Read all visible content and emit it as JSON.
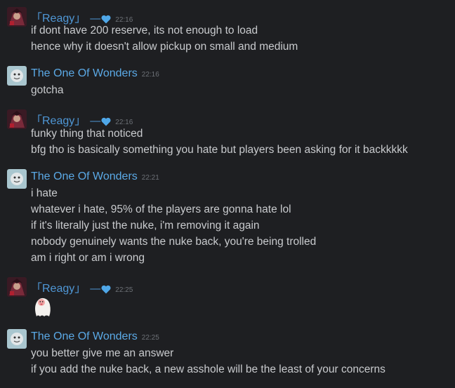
{
  "colors": {
    "background": "#1e1f22",
    "name_color": "#5ba9e6",
    "reagy_color": "#4f97d6",
    "heart": "#4fa7e8",
    "time": "#6d7177",
    "text": "#c9cbce"
  },
  "messages": [
    {
      "author": "「Reagy」",
      "decoration": "—",
      "decoration_icon": "heart-icon",
      "time": "22:16",
      "avatar": "reagy-avatar",
      "lines": [
        "if dont have 200 reserve, its not enough to load",
        "hence why it doesn't allow pickup on small and medium"
      ]
    },
    {
      "author": "The One Of Wonders",
      "time": "22:16",
      "avatar": "wonders-avatar",
      "lines": [
        "gotcha"
      ]
    },
    {
      "author": "「Reagy」",
      "decoration": "—",
      "decoration_icon": "heart-icon",
      "time": "22:16",
      "avatar": "reagy-avatar",
      "lines": [
        "funky thing that noticed",
        "bfg tho is basically something you hate but players been asking for it backkkkk"
      ]
    },
    {
      "author": "The One Of Wonders",
      "time": "22:21",
      "avatar": "wonders-avatar",
      "lines": [
        "i hate",
        "whatever i hate, 95% of the players are gonna hate lol",
        "if it's literally just the nuke, i'm removing it again",
        "nobody genuinely wants the nuke back, you're being trolled",
        "am i right or am i wrong"
      ]
    },
    {
      "author": "「Reagy」",
      "decoration": "—",
      "decoration_icon": "heart-icon",
      "time": "22:25",
      "avatar": "reagy-avatar",
      "sticker": "ghost-emote-icon",
      "lines": []
    },
    {
      "author": "The One Of Wonders",
      "time": "22:25",
      "avatar": "wonders-avatar",
      "lines": [
        "you better give me an answer",
        "if you add the nuke back, a new asshole will be the least of your concerns"
      ]
    }
  ]
}
